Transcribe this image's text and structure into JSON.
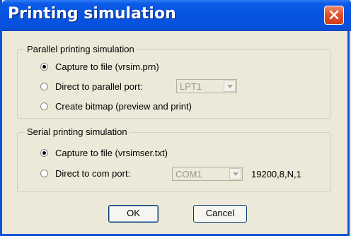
{
  "window": {
    "title": "Printing simulation"
  },
  "parallel": {
    "legend": "Parallel printing simulation",
    "options": [
      {
        "label": "Capture to file (vrsim.prn)",
        "checked": true
      },
      {
        "label": "Direct to parallel port:",
        "checked": false
      },
      {
        "label": "Create bitmap (preview and print)",
        "checked": false
      }
    ],
    "port": "LPT1"
  },
  "serial": {
    "legend": "Serial printing simulation",
    "options": [
      {
        "label": "Capture to file (vrsimser.txt)",
        "checked": true
      },
      {
        "label": "Direct to com port:",
        "checked": false
      }
    ],
    "port": "COM1",
    "settings": "19200,8,N,1"
  },
  "buttons": {
    "ok": "OK",
    "cancel": "Cancel"
  },
  "colors": {
    "title_bar": "#0653df",
    "dialog_bg": "#ece9d8",
    "close_button": "#e4512a"
  },
  "icons": {
    "close": "close-icon",
    "dropdown": "chevron-down-icon"
  }
}
